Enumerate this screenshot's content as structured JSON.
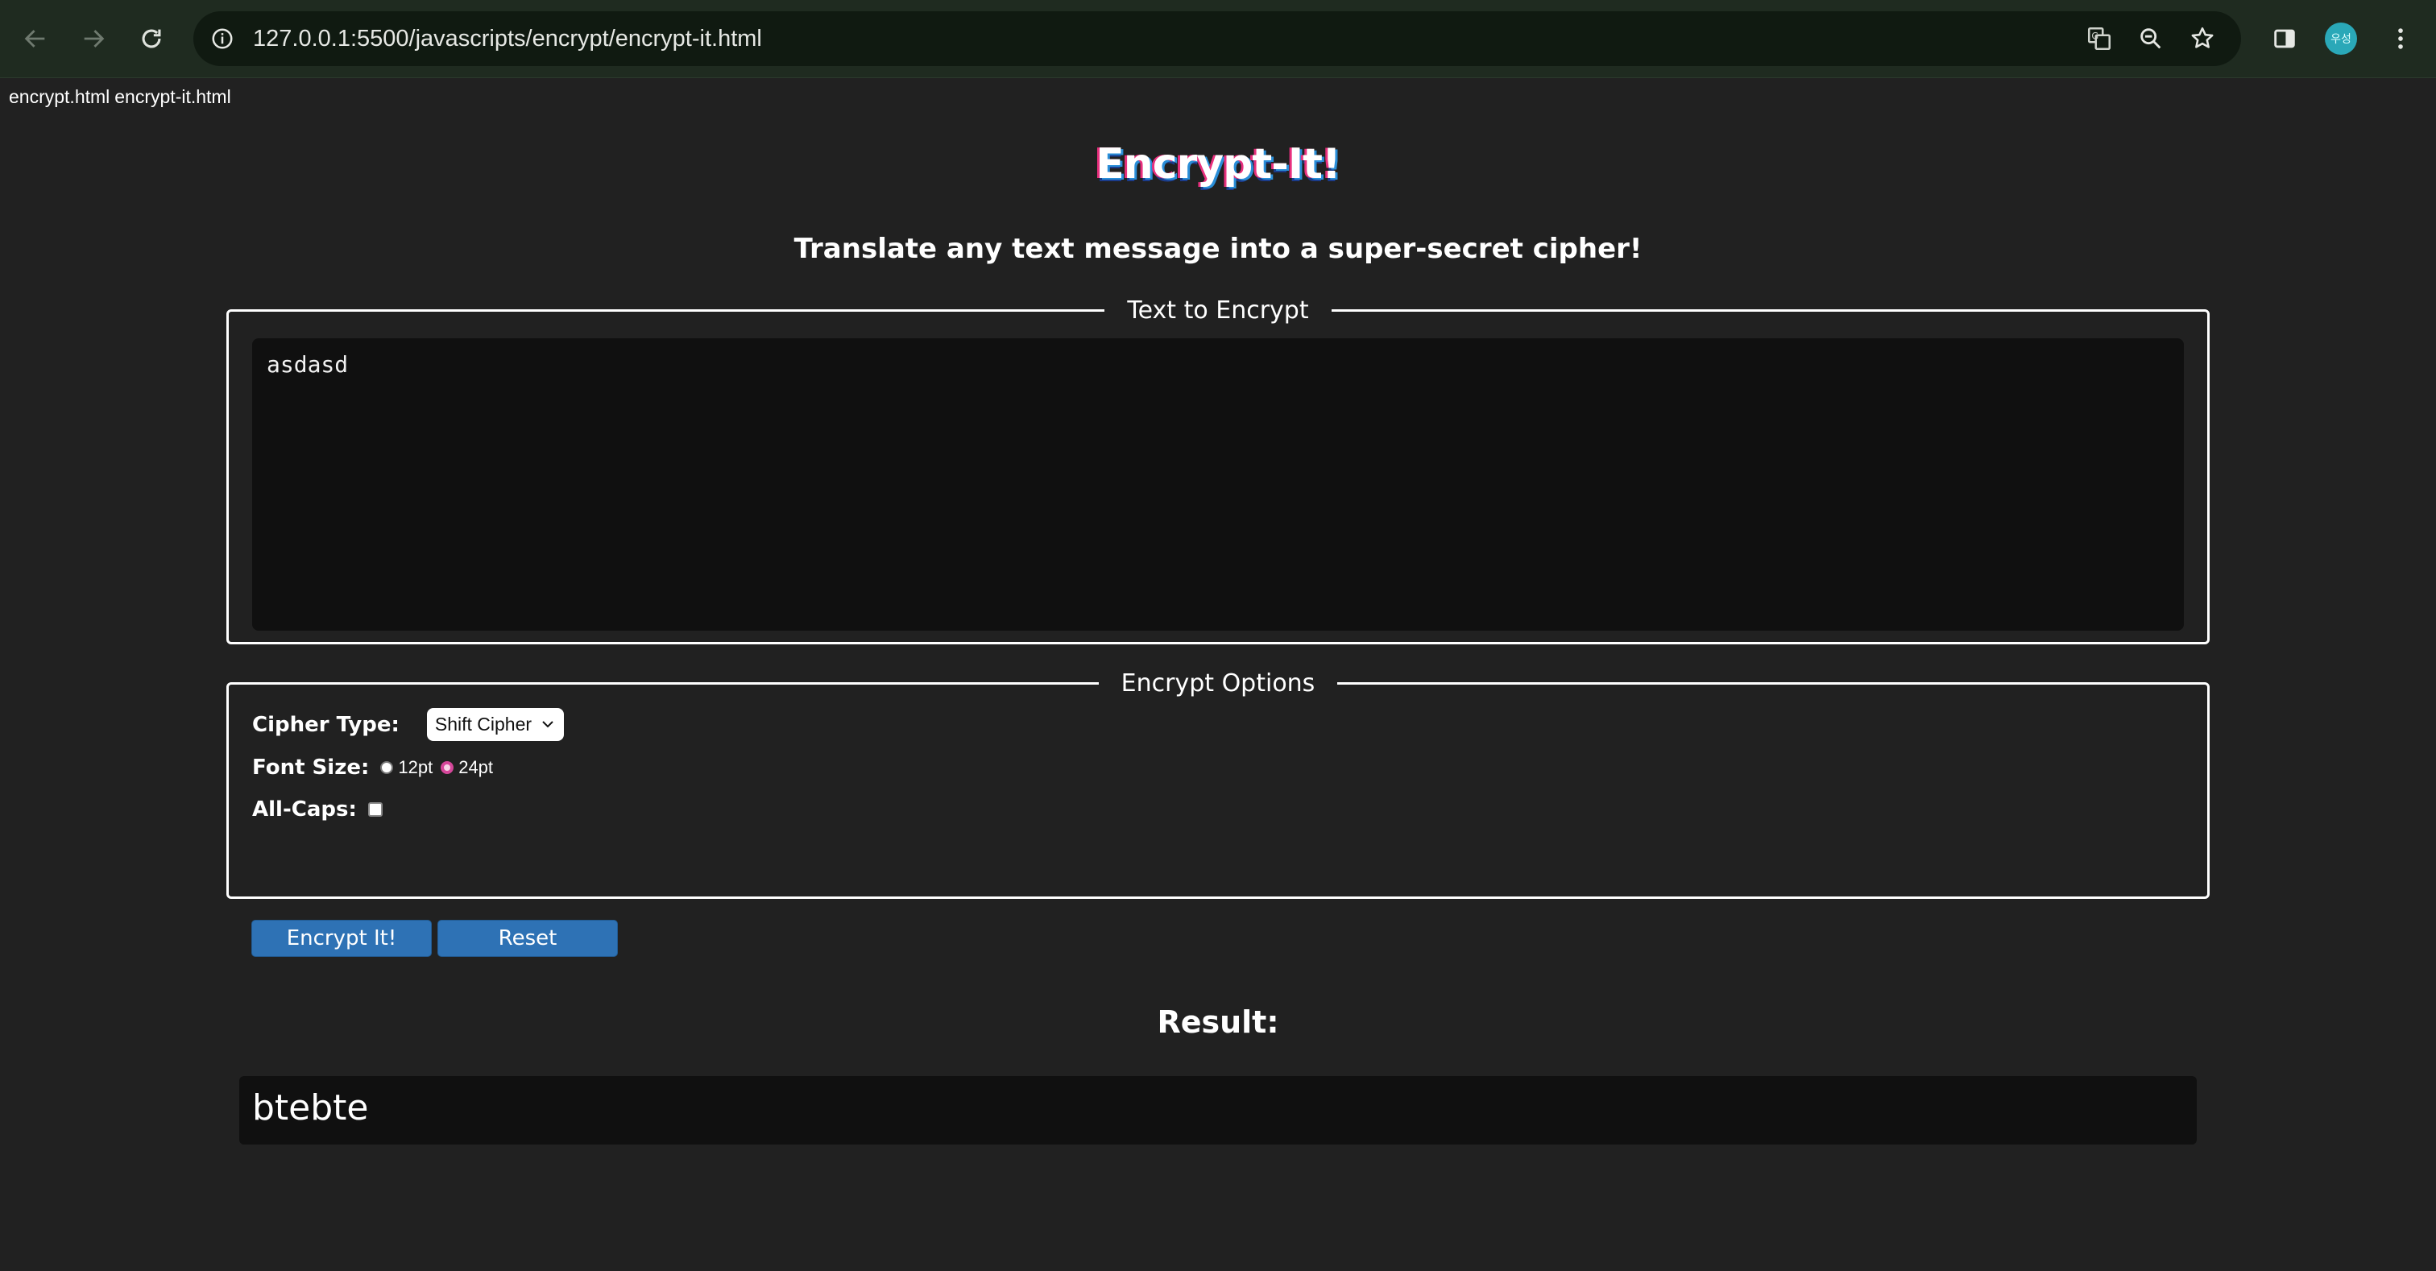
{
  "browser": {
    "url": "127.0.0.1:5500/javascripts/encrypt/encrypt-it.html",
    "profile_initials": "우성",
    "accent_color": "#2aa8b8"
  },
  "file_links": [
    "encrypt.html",
    "encrypt-it.html"
  ],
  "header": {
    "title": "Encrypt-It!",
    "subtitle": "Translate any text message into a super-secret cipher!"
  },
  "text_section": {
    "legend": "Text to Encrypt",
    "input_value": "asdasd"
  },
  "options": {
    "legend": "Encrypt Options",
    "cipher_type_label": "Cipher Type:",
    "cipher_type_value": "Shift Cipher",
    "font_size_label": "Font Size:",
    "font_size_options": [
      {
        "label": "12pt",
        "checked": false
      },
      {
        "label": "24pt",
        "checked": true
      }
    ],
    "all_caps_label": "All-Caps:",
    "all_caps_checked": false,
    "encrypt_button": "Encrypt It!",
    "reset_button": "Reset",
    "button_color": "#2e72b5"
  },
  "result": {
    "heading": "Result:",
    "value": "btebte"
  }
}
